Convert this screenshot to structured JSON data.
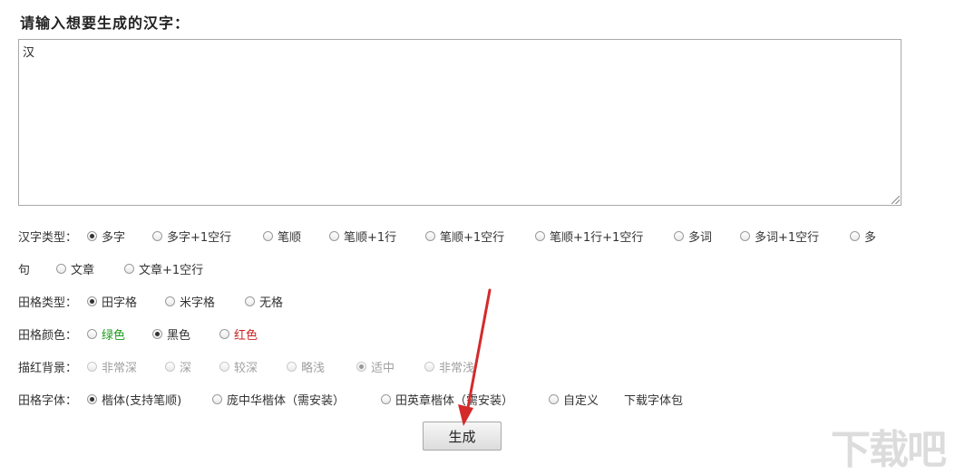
{
  "prompt_label": "请输入想要生成的汉字：",
  "input_value": "汉",
  "char_type": {
    "label": "汉字类型：",
    "options": [
      "多字",
      "多字+1空行",
      "笔顺",
      "笔顺+1行",
      "笔顺+1空行",
      "笔顺+1行+1空行",
      "多词",
      "多词+1空行",
      "多",
      "句",
      "文章",
      "文章+1空行"
    ],
    "selected": "多字"
  },
  "grid_type": {
    "label": "田格类型：",
    "options": [
      "田字格",
      "米字格",
      "无格"
    ],
    "selected": "田字格"
  },
  "grid_color": {
    "label": "田格颜色：",
    "options": [
      "绿色",
      "黑色",
      "红色"
    ],
    "selected": "黑色",
    "colors": {
      "green": "#1a9a1a",
      "red": "#cc2222"
    }
  },
  "trace_bg": {
    "label": "描红背景：",
    "options": [
      "非常深",
      "深",
      "较深",
      "略浅",
      "适中",
      "非常浅"
    ],
    "selected": "适中",
    "disabled": true
  },
  "grid_font": {
    "label": "田格字体：",
    "options": [
      "楷体(支持笔顺)",
      "庞中华楷体（需安装）",
      "田英章楷体（需安装）",
      "自定义"
    ],
    "selected": "楷体(支持笔顺)",
    "download_link": "下载字体包"
  },
  "generate_button": "生成",
  "annotation_arrow_color": "#d42a2a",
  "watermark_text": "下载吧"
}
